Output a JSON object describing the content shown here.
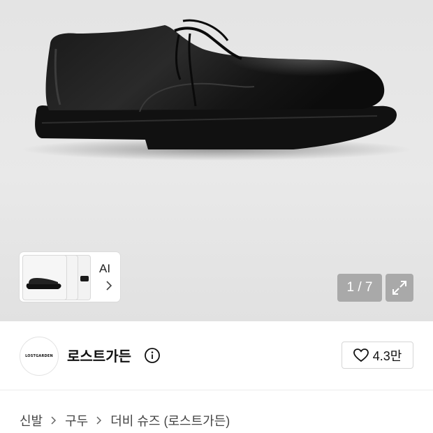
{
  "gallery": {
    "counter": "1 / 7",
    "ai_label": "AI"
  },
  "brand": {
    "name": "로스트가든",
    "logo_text": "LOSTGARDEN",
    "likes": "4.3만"
  },
  "breadcrumb": {
    "items": [
      "신발",
      "구두",
      "더비 슈즈 (로스트가든)"
    ]
  },
  "colors": {
    "hero_bg": "#e6e6e6",
    "overlay": "#969696",
    "divider": "#ececec"
  }
}
